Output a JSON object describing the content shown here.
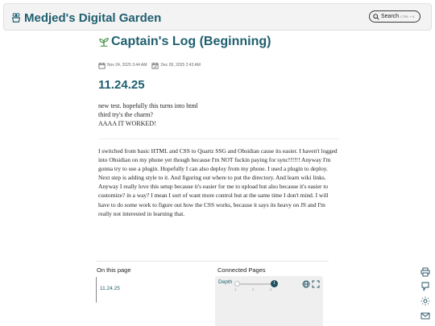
{
  "site": {
    "title": "Medjed's Digital Garden",
    "logo_icon": "garden-logo-icon"
  },
  "search": {
    "label": "Search",
    "shortcut": "CTRL + K"
  },
  "page": {
    "title": "Captain's Log (Beginning)",
    "title_icon": "sprout-icon",
    "created": "Nov 24, 2025 3:44 AM",
    "modified": "Dec 05, 2025 2:43 AM"
  },
  "section": {
    "heading": "11.24.25",
    "lines": [
      "new test. hopefully this turns into html",
      "third try's the charm?",
      "AAAA IT WORKED!"
    ],
    "paragraph": "I switched from basic HTML and CSS to Quartz SSG and Obsidian cause its easier. I haven't logged into Obsidian on my phone yet though because I'm NOT fuckin paying for sync!!!!!! Anyway I'm gonna try to use a plugin. Hopefully I can also deploy from my phone. I used a plugin to deploy. Next step is adding style to it. And figuring out where to put the directory. And learn wiki links. Anyway I really love this setup because it's easier for me to upload but also because it's easier to customize? in a way? I mean I sort of want more control but at the same time I don't mind. I will have to do some work to figure out how the CSS works, because it says its heavy on JS and I'm really not interested in learning that."
  },
  "toc": {
    "title": "On this page",
    "items": [
      "11.24.25"
    ]
  },
  "graph": {
    "title": "Connected Pages",
    "depth_label": "Depth",
    "depth_value": "1",
    "depth_ticks": [
      "1",
      "2",
      "3"
    ]
  },
  "colors": {
    "accent": "#1f5f6f",
    "panel": "#efefef"
  }
}
